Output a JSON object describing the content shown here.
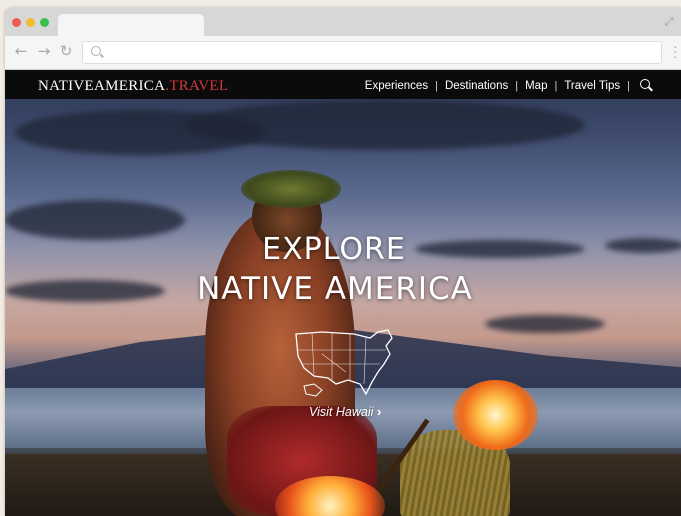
{
  "browser": {
    "window_controls": [
      "close",
      "minimize",
      "maximize"
    ],
    "icons": {
      "back": "back-arrow-icon",
      "forward": "forward-arrow-icon",
      "reload": "reload-icon",
      "search": "search-icon",
      "expand": "expand-icon",
      "menu": "menu-dots-icon"
    },
    "address_value": ""
  },
  "site": {
    "brand_main": "NATIVEAMERICA",
    "brand_accent": ".TRAVEL",
    "nav": [
      "Experiences",
      "Destinations",
      "Map",
      "Travel Tips"
    ],
    "separator": "|",
    "hero": {
      "line1": "EXPLORE",
      "line2": "NATIVE AMERICA",
      "cta": "Visit Hawaii",
      "cta_chevron": "›"
    }
  },
  "colors": {
    "brand_accent": "#d43a3a",
    "header_bg": "#0b0b0b"
  }
}
